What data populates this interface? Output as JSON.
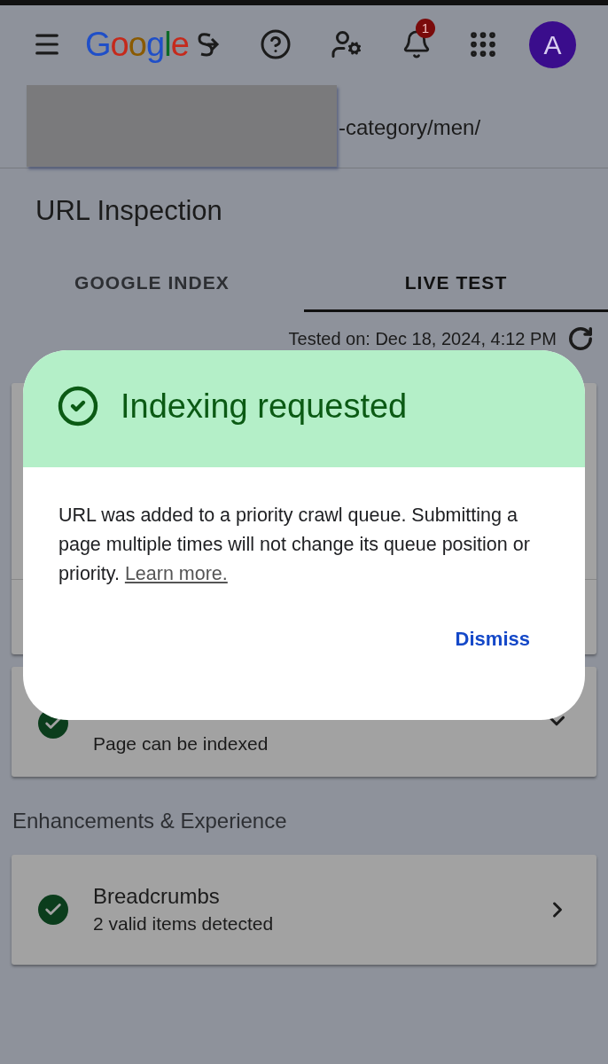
{
  "header": {
    "logo": "Google",
    "notification_count": "1",
    "avatar_letter": "A"
  },
  "url": {
    "text": "-category/men/"
  },
  "page_title": "URL Inspection",
  "tabs": [
    {
      "label": "GOOGLE INDEX",
      "selected": false
    },
    {
      "label": "LIVE TEST",
      "selected": true
    }
  ],
  "tested_on": "Tested on: Dec 18, 2024, 4:12 PM",
  "cards": [
    {
      "kind": "hidden"
    },
    {
      "kind": "expand",
      "subtitle": "Page can be indexed"
    }
  ],
  "section_title": "Enhancements & Experience",
  "enhancements": [
    {
      "title": "Breadcrumbs",
      "subtitle": "2 valid items detected"
    }
  ],
  "dialog": {
    "title": "Indexing requested",
    "body": "URL was added to a priority crawl queue. Submitting a page multiple times will not change its queue position or priority.",
    "link": "Learn more.",
    "button": "Dismiss"
  }
}
